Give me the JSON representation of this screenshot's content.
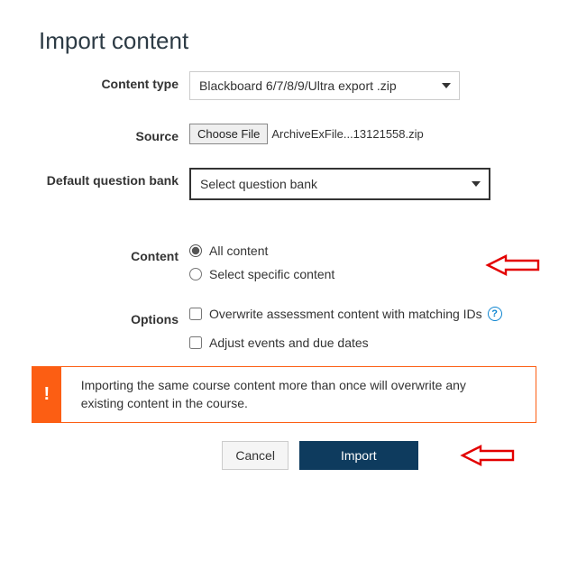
{
  "title": "Import content",
  "labels": {
    "content_type": "Content type",
    "source": "Source",
    "question_bank": "Default question bank",
    "content": "Content",
    "options": "Options"
  },
  "content_type_value": "Blackboard 6/7/8/9/Ultra export .zip",
  "source": {
    "button": "Choose File",
    "file_name": "ArchiveExFile...13121558.zip"
  },
  "question_bank_value": "Select question bank",
  "content_radios": {
    "all": "All content",
    "select": "Select specific content"
  },
  "options_checks": {
    "overwrite": "Overwrite assessment content with matching IDs",
    "adjust": "Adjust events and due dates"
  },
  "help_glyph": "?",
  "alert": {
    "icon": "!",
    "text": "Importing the same course content more than once will overwrite any existing content in the course."
  },
  "buttons": {
    "cancel": "Cancel",
    "import": "Import"
  }
}
